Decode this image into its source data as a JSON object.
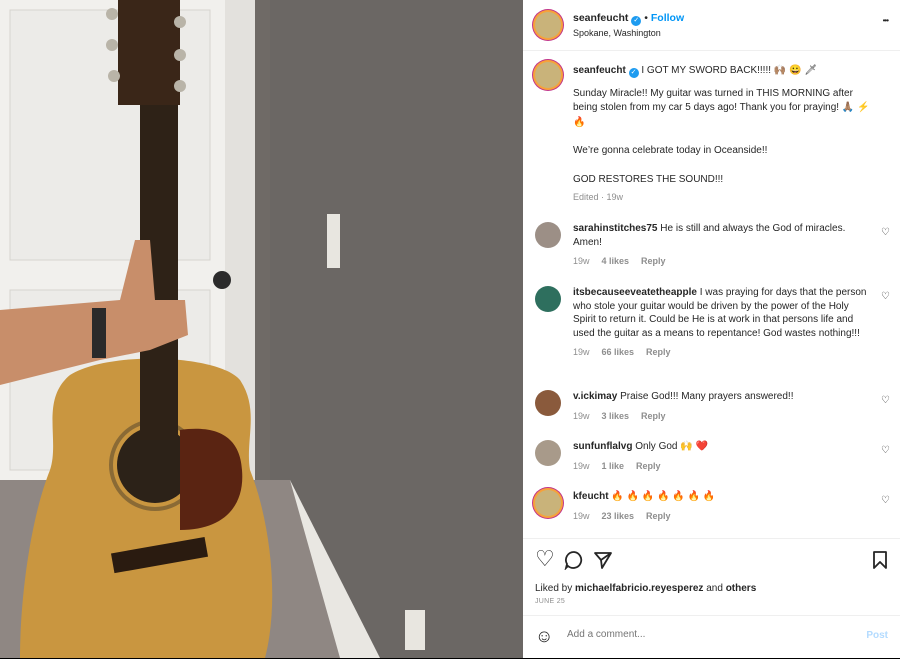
{
  "header": {
    "username": "seanfeucht",
    "follow_label": "Follow",
    "location": "Spokane, Washington",
    "separator": "•",
    "more": "•••"
  },
  "caption": {
    "username": "seanfeucht",
    "title": "I GOT MY SWORD BACK!!!!! 🙌🏽 😀 🗡",
    "line1": "Sunday Miracle!! My guitar was turned in THIS MORNING after being stolen from my car 5 days ago! Thank you for praying! 🙏🏽 ⚡ 🔥",
    "line2": "We’re gonna celebrate today in Oceanside!!",
    "line3": "GOD RESTORES THE SOUND!!!",
    "meta": "Edited · 19w"
  },
  "comments": [
    {
      "username": "sarahinstitches75",
      "text": "He is still and always the God of miracles. Amen!",
      "time": "19w",
      "likes": "4 likes",
      "reply": "Reply"
    },
    {
      "username": "itsbecauseeveatetheapple",
      "text": "I was praying for days that the person who stole your guitar would be driven by the power of the Holy Spirit to return it. Could be He is at work in that persons life and used the guitar as a means to repentance! God wastes nothing!!!",
      "time": "19w",
      "likes": "66 likes",
      "reply": "Reply"
    },
    {
      "username": "v.ickimay",
      "text": "Praise God!!! Many prayers answered!!",
      "time": "19w",
      "likes": "3 likes",
      "reply": "Reply"
    },
    {
      "username": "sunfunflalvg",
      "text": "Only God 🙌 ❤️",
      "time": "19w",
      "likes": "1 like",
      "reply": "Reply"
    },
    {
      "username": "kfeucht",
      "text": "🔥 🔥 🔥 🔥 🔥 🔥 🔥",
      "time": "19w",
      "likes": "23 likes",
      "reply": "Reply"
    }
  ],
  "likes": {
    "prefix": "Liked by ",
    "user": "michaelfabricio.reyesperez",
    "and": " and ",
    "others": "others",
    "date": "JUNE 25"
  },
  "add_comment": {
    "emoji": "☺",
    "placeholder": "Add a comment...",
    "post": "Post"
  },
  "icons": {
    "heart": "♡",
    "comment": "💬",
    "share": "➤",
    "bookmark": "🔖"
  },
  "colors": {
    "accent": "#0095f6",
    "verified": "#1d9bf0",
    "story_ring": "#c1358a"
  }
}
